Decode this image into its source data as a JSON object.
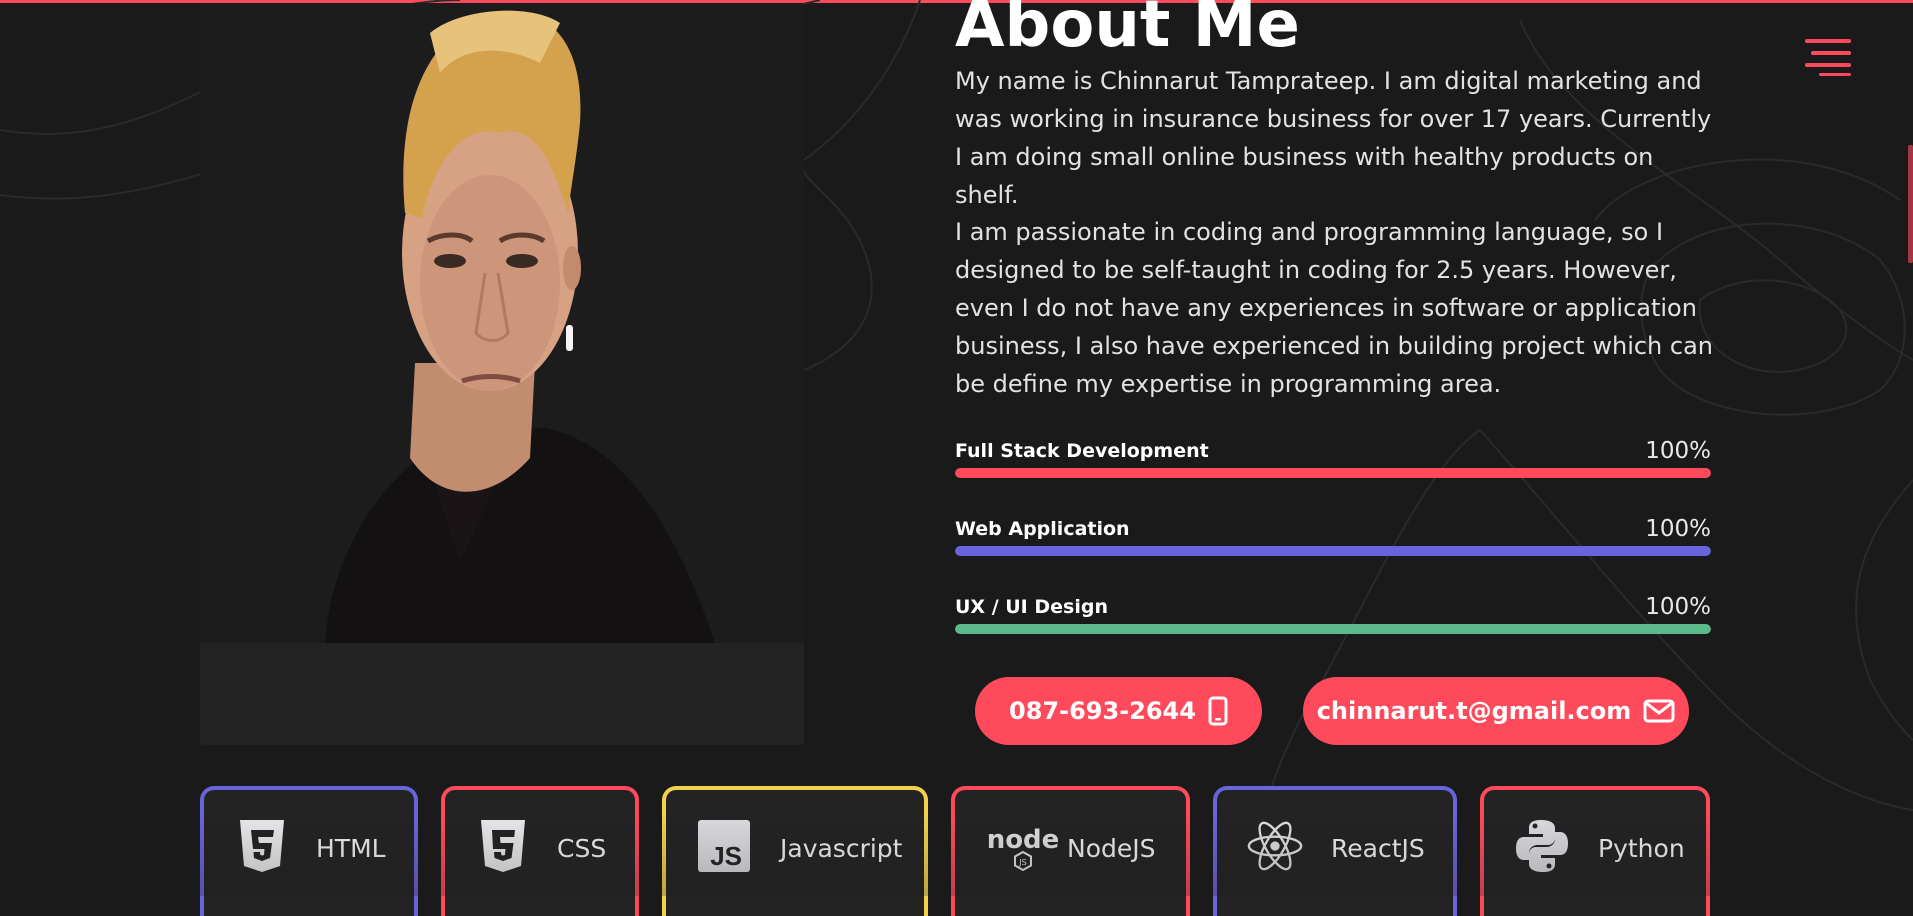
{
  "about": {
    "title": "About Me",
    "paragraph1": "My name is Chinnarut Tamprateep. I am digital marketing and was working in insurance business for over 17 years. Currently I am doing small online business with healthy products on shelf.",
    "paragraph2": "I am passionate in coding and programming language, so I designed to be self-taught in coding for 2.5 years. However, even I do not have any experiences in software or application business, I also have experienced in building project which can be define my expertise in programming area."
  },
  "skills": [
    {
      "name": "Full Stack Development",
      "percent_label": "100%",
      "level": 100,
      "color": "#ff4a5c"
    },
    {
      "name": "Web Application",
      "percent_label": "100%",
      "level": 100,
      "color": "#6a64dc"
    },
    {
      "name": "UX / UI Design",
      "percent_label": "100%",
      "level": 100,
      "color": "#5cb98a"
    }
  ],
  "contact": {
    "phone": "087-693-2644",
    "phone_icon": "mobile-phone-icon",
    "email": "chinnarut.t@gmail.com",
    "email_icon": "envelope-icon"
  },
  "tech": [
    {
      "label": "HTML",
      "icon": "html5-icon",
      "color": "#6a64dc"
    },
    {
      "label": "CSS",
      "icon": "css3-icon",
      "color": "#ff4a5c"
    },
    {
      "label": "Javascript",
      "icon": "js-icon",
      "color": "#f2d24c"
    },
    {
      "label": "NodeJS",
      "icon": "nodejs-icon",
      "color": "#ff4a5c"
    },
    {
      "label": "ReactJS",
      "icon": "react-icon",
      "color": "#6a64dc"
    },
    {
      "label": "Python",
      "icon": "python-icon",
      "color": "#ff4a5c"
    }
  ],
  "colors": {
    "accent": "#ff4a5c",
    "background": "#1a1a1b",
    "card": "#232324"
  },
  "menu_icon": "hamburger-menu-icon"
}
